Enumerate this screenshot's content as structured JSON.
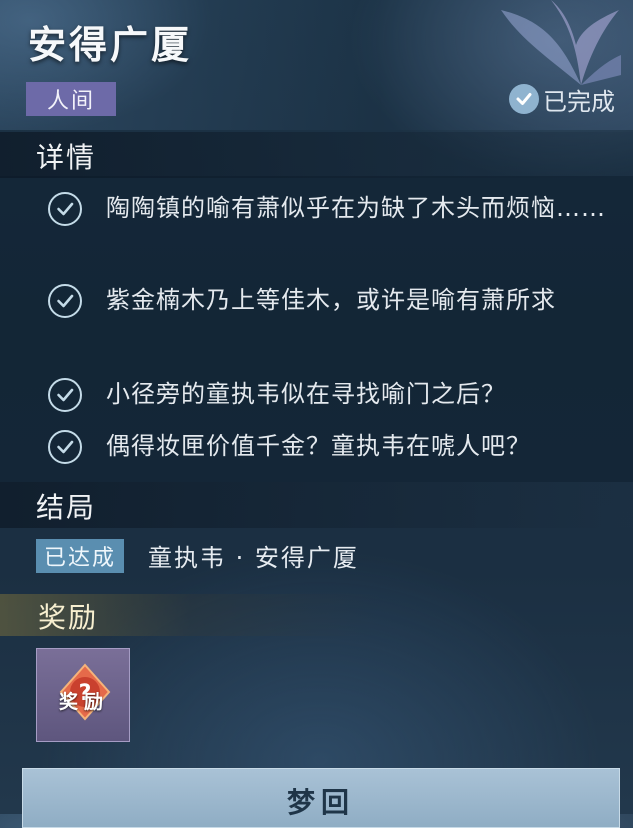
{
  "header": {
    "title": "安得广厦",
    "world_tag": "人间",
    "status_label": "已完成"
  },
  "details": {
    "section_title": "详情",
    "items": [
      "陶陶镇的喻有萧似乎在为缺了木头而烦恼……",
      "紫金楠木乃上等佳木，或许是喻有萧所求",
      "小径旁的童执韦似在寻找喻门之后？",
      "偶得妆匣价值千金？童执韦在唬人吧？"
    ]
  },
  "ending": {
    "section_title": "结局",
    "achieved_tag": "已达成",
    "name": "童执韦 · 安得广厦"
  },
  "reward": {
    "section_title": "奖励",
    "item_label": "奖励"
  },
  "actions": {
    "dream_button": "梦回"
  },
  "colors": {
    "world_tag": "#6d6aa8",
    "achieved_tag": "#5a8eb0",
    "check": "#c4dbe8"
  }
}
